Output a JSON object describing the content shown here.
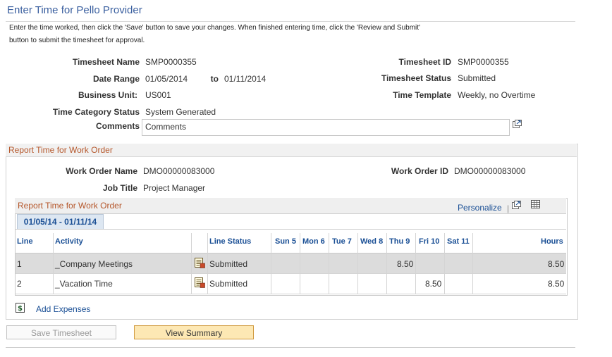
{
  "page": {
    "title": "Enter Time for Pello Provider",
    "instructions_line1": "Enter the time worked, then click the 'Save' button to save your changes.  When finished entering time, click the 'Review and Submit'",
    "instructions_line2": "button to submit the timesheet for approval."
  },
  "header": {
    "timesheet_name_label": "Timesheet Name",
    "timesheet_name": "SMP0000355",
    "date_range_label": "Date Range",
    "date_from": "01/05/2014",
    "to_label": "to",
    "date_to": "01/11/2014",
    "business_unit_label": "Business Unit:",
    "business_unit": "US001",
    "time_category_status_label": "Time Category Status",
    "time_category_status": "System Generated",
    "comments_label": "Comments",
    "comments_value": "Comments",
    "timesheet_id_label": "Timesheet ID",
    "timesheet_id": "SMP0000355",
    "timesheet_status_label": "Timesheet Status",
    "timesheet_status": "Submitted",
    "time_template_label": "Time Template",
    "time_template": "Weekly, no Overtime"
  },
  "work_order": {
    "section_title": "Report Time for Work Order",
    "work_order_name_label": "Work Order Name",
    "work_order_name": "DMO00000083000",
    "job_title_label": "Job Title",
    "job_title": "Project Manager",
    "work_order_id_label": "Work Order ID",
    "work_order_id": "DMO00000083000"
  },
  "grid": {
    "title": "Report Time for Work Order",
    "personalize_label": "Personalize",
    "separator": "|",
    "tab_label": "01/05/14 - 01/11/14",
    "columns": {
      "line": "Line",
      "activity": "Activity",
      "line_status": "Line Status",
      "sun": "Sun 5",
      "mon": "Mon 6",
      "tue": "Tue 7",
      "wed": "Wed 8",
      "thu": "Thu 9",
      "fri": "Fri 10",
      "sat": "Sat 11",
      "hours": "Hours"
    },
    "rows": [
      {
        "line": "1",
        "activity": "_Company Meetings",
        "status": "Submitted",
        "thu": "8.50",
        "fri": "",
        "hours": "8.50"
      },
      {
        "line": "2",
        "activity": "_Vacation Time",
        "status": "Submitted",
        "thu": "",
        "fri": "8.50",
        "hours": "8.50"
      }
    ]
  },
  "actions": {
    "add_expenses": "Add Expenses",
    "save_timesheet": "Save Timesheet",
    "view_summary": "View Summary"
  },
  "colors": {
    "title_blue": "#3a5f9f",
    "link_blue": "#1a4f95",
    "section_orange": "#b5572b",
    "primary_button": "#fde8b4"
  }
}
